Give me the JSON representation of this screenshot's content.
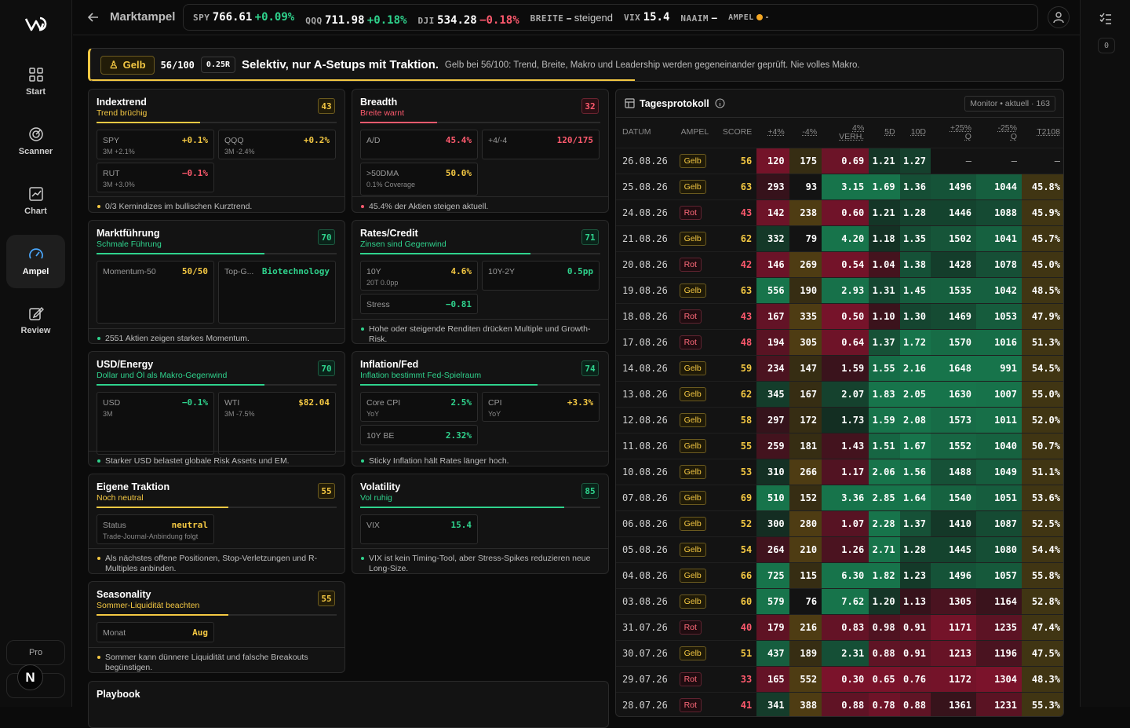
{
  "sidebar": {
    "items": [
      {
        "label": "Start"
      },
      {
        "label": "Scanner"
      },
      {
        "label": "Chart"
      },
      {
        "label": "Ampel"
      },
      {
        "label": "Review"
      }
    ],
    "pro": "Pro",
    "avatar": "N"
  },
  "topbar": {
    "title": "Marktampel",
    "tickers": [
      {
        "label": "SPY",
        "value": "766.61",
        "change": "+0.09%"
      },
      {
        "label": "QQQ",
        "value": "711.98",
        "change": "+0.18%"
      },
      {
        "label": "DJI",
        "value": "534.28",
        "change": "−0.18%"
      }
    ],
    "breite_label": "BREITE",
    "breite_value": "steigend",
    "vix_label": "VIX",
    "vix_value": "15.4",
    "naaim_label": "NAAIM",
    "naaim_value": "–",
    "ampel_label": "AMPEL",
    "ampel_value": "-"
  },
  "rightrail": {
    "badge": "0"
  },
  "banner": {
    "tag": "Gelb",
    "score": "56/100",
    "r": "0.25R",
    "headline": "Selektiv, nur A-Setups mit Traktion.",
    "sub": "Gelb bei 56/100: Trend, Breite, Makro und Leadership werden gegeneinander geprüft. Nie volles Makro.",
    "progress": 0.56
  },
  "colors": {
    "green": "#2fd38d",
    "red": "#ff5a6e",
    "yellow": "#f4c843"
  },
  "cards": {
    "indextrend": {
      "title": "Indextrend",
      "sub": "Trend brüchig",
      "score": "43",
      "fill": 0.43,
      "tiles": [
        {
          "l": "SPY",
          "v": "+0.1%",
          "s": "3M +2.1%"
        },
        {
          "l": "QQQ",
          "v": "+0.2%",
          "s": "3M -2.4%"
        },
        {
          "l": "RUT",
          "v": "−0.1%",
          "s": "3M +3.0%"
        }
      ],
      "foot": "0/3 Kernindizes im bullischen Kurztrend."
    },
    "breadth": {
      "title": "Breadth",
      "sub": "Breite warnt",
      "score": "32",
      "fill": 0.32,
      "tiles": [
        {
          "l": "A/D",
          "v": "45.4%",
          "s": ""
        },
        {
          "l": "+4/-4",
          "v": "120/175",
          "s": ""
        },
        {
          "l": ">50DMA",
          "v": "50.0%",
          "s": "0.1% Coverage"
        }
      ],
      "foot": "45.4% der Aktien steigen aktuell."
    },
    "markt": {
      "title": "Marktführung",
      "sub": "Schmale Führung",
      "score": "70",
      "fill": 0.7,
      "tiles": [
        {
          "l": "Momentum-50",
          "v": "50/50",
          "s": ""
        },
        {
          "l": "Top-G...",
          "v": "Biotechnology",
          "s": ""
        }
      ],
      "foot": "2551 Aktien zeigen starkes Momentum."
    },
    "rates": {
      "title": "Rates/Credit",
      "sub": "Zinsen sind Gegenwind",
      "score": "71",
      "fill": 0.71,
      "tiles": [
        {
          "l": "10Y",
          "v": "4.6%",
          "s": "20T 0.0pp"
        },
        {
          "l": "10Y-2Y",
          "v": "0.5pp",
          "s": ""
        },
        {
          "l": "Stress",
          "v": "−0.81",
          "s": ""
        }
      ],
      "foot": "Hohe oder steigende Renditen drücken Multiple und Growth-Risk."
    },
    "usd": {
      "title": "USD/Energy",
      "sub": "Dollar und Öl als Makro-Gegenwind",
      "score": "70",
      "fill": 0.7,
      "tiles": [
        {
          "l": "USD",
          "v": "−0.1%",
          "s": "3M"
        },
        {
          "l": "WTI",
          "v": "$82.04",
          "s": "3M -7.5%"
        }
      ],
      "foot": "Starker USD belastet globale Risk Assets und EM."
    },
    "infl": {
      "title": "Inflation/Fed",
      "sub": "Inflation bestimmt Fed-Spielraum",
      "score": "74",
      "fill": 0.74,
      "tiles": [
        {
          "l": "Core CPI",
          "v": "2.5%",
          "s": "YoY"
        },
        {
          "l": "CPI",
          "v": "+3.3%",
          "s": "YoY"
        },
        {
          "l": "10Y BE",
          "v": "2.32%",
          "s": ""
        }
      ],
      "foot": "Sticky Inflation hält Rates länger hoch."
    },
    "eigene": {
      "title": "Eigene Traktion",
      "sub": "Noch neutral",
      "score": "55",
      "fill": 0.55,
      "tiles": [
        {
          "l": "Status",
          "v": "neutral",
          "s": "Trade-Journal-Anbindung folgt"
        }
      ],
      "foot": "Als nächstes offene Positionen, Stop-Verletzungen und R-Multiples anbinden."
    },
    "vola": {
      "title": "Volatility",
      "sub": "Vol ruhig",
      "score": "85",
      "fill": 0.85,
      "tiles": [
        {
          "l": "VIX",
          "v": "15.4",
          "s": ""
        }
      ],
      "foot": "VIX ist kein Timing-Tool, aber Stress-Spikes reduzieren neue Long-Size."
    },
    "season": {
      "title": "Seasonality",
      "sub": "Sommer-Liquidität beachten",
      "score": "55",
      "fill": 0.55,
      "tiles": [
        {
          "l": "Monat",
          "v": "Aug",
          "s": ""
        }
      ],
      "foot": "Sommer kann dünnere Liquidität und falsche Breakouts begünstigen."
    },
    "playbook": {
      "title": "Playbook"
    }
  },
  "protocol": {
    "title": "Tagesprotokoll",
    "monitor": "Monitor • aktuell · 163",
    "headers": [
      "DATUM",
      "AMPEL",
      "SCORE",
      "+4%",
      "-4%",
      "4% VERH.",
      "5D",
      "10D",
      "+25% Q",
      "-25% Q",
      "T2108"
    ],
    "rows": [
      [
        "26.08.26",
        "Gelb",
        "56",
        "120",
        "175",
        "0.69",
        "1.21",
        "1.27",
        "–",
        "–",
        "–"
      ],
      [
        "25.08.26",
        "Gelb",
        "63",
        "293",
        "93",
        "3.15",
        "1.69",
        "1.36",
        "1496",
        "1044",
        "45.8%"
      ],
      [
        "24.08.26",
        "Rot",
        "43",
        "142",
        "238",
        "0.60",
        "1.21",
        "1.28",
        "1446",
        "1088",
        "45.9%"
      ],
      [
        "21.08.26",
        "Gelb",
        "62",
        "332",
        "79",
        "4.20",
        "1.18",
        "1.35",
        "1502",
        "1041",
        "45.7%"
      ],
      [
        "20.08.26",
        "Rot",
        "42",
        "146",
        "269",
        "0.54",
        "1.04",
        "1.38",
        "1428",
        "1078",
        "45.0%"
      ],
      [
        "19.08.26",
        "Gelb",
        "63",
        "556",
        "190",
        "2.93",
        "1.31",
        "1.45",
        "1535",
        "1042",
        "48.5%"
      ],
      [
        "18.08.26",
        "Rot",
        "43",
        "167",
        "335",
        "0.50",
        "1.10",
        "1.30",
        "1469",
        "1053",
        "47.9%"
      ],
      [
        "17.08.26",
        "Rot",
        "48",
        "194",
        "305",
        "0.64",
        "1.37",
        "1.72",
        "1570",
        "1016",
        "51.3%"
      ],
      [
        "14.08.26",
        "Gelb",
        "59",
        "234",
        "147",
        "1.59",
        "1.55",
        "2.16",
        "1648",
        "991",
        "54.5%"
      ],
      [
        "13.08.26",
        "Gelb",
        "62",
        "345",
        "167",
        "2.07",
        "1.83",
        "2.05",
        "1630",
        "1007",
        "55.0%"
      ],
      [
        "12.08.26",
        "Gelb",
        "58",
        "297",
        "172",
        "1.73",
        "1.59",
        "2.08",
        "1573",
        "1011",
        "52.0%"
      ],
      [
        "11.08.26",
        "Gelb",
        "55",
        "259",
        "181",
        "1.43",
        "1.51",
        "1.67",
        "1552",
        "1040",
        "50.7%"
      ],
      [
        "10.08.26",
        "Gelb",
        "53",
        "310",
        "266",
        "1.17",
        "2.06",
        "1.56",
        "1488",
        "1049",
        "51.1%"
      ],
      [
        "07.08.26",
        "Gelb",
        "69",
        "510",
        "152",
        "3.36",
        "2.85",
        "1.64",
        "1540",
        "1051",
        "53.6%"
      ],
      [
        "06.08.26",
        "Gelb",
        "52",
        "300",
        "280",
        "1.07",
        "2.28",
        "1.37",
        "1410",
        "1087",
        "52.5%"
      ],
      [
        "05.08.26",
        "Gelb",
        "54",
        "264",
        "210",
        "1.26",
        "2.71",
        "1.28",
        "1445",
        "1080",
        "54.4%"
      ],
      [
        "04.08.26",
        "Gelb",
        "66",
        "725",
        "115",
        "6.30",
        "1.82",
        "1.23",
        "1496",
        "1057",
        "55.8%"
      ],
      [
        "03.08.26",
        "Gelb",
        "60",
        "579",
        "76",
        "7.62",
        "1.20",
        "1.13",
        "1305",
        "1164",
        "52.8%"
      ],
      [
        "31.07.26",
        "Rot",
        "40",
        "179",
        "216",
        "0.83",
        "0.98",
        "0.91",
        "1171",
        "1235",
        "47.4%"
      ],
      [
        "30.07.26",
        "Gelb",
        "51",
        "437",
        "189",
        "2.31",
        "0.88",
        "0.91",
        "1213",
        "1196",
        "47.5%"
      ],
      [
        "29.07.26",
        "Rot",
        "33",
        "165",
        "552",
        "0.30",
        "0.65",
        "0.76",
        "1172",
        "1304",
        "48.3%"
      ],
      [
        "28.07.26",
        "Rot",
        "41",
        "341",
        "388",
        "0.88",
        "0.78",
        "0.88",
        "1361",
        "1231",
        "55.3%"
      ]
    ]
  }
}
